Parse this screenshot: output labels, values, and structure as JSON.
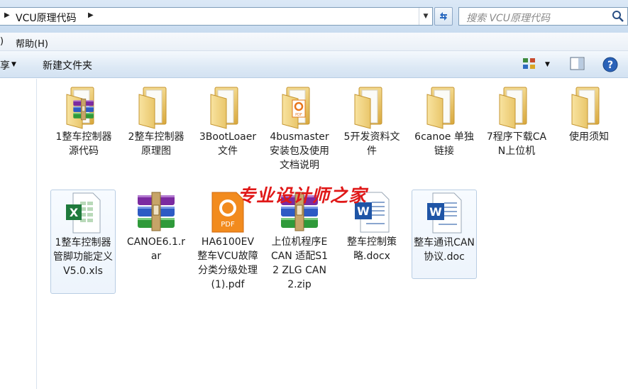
{
  "address": {
    "path": "VCU原理代码",
    "search_placeholder": "搜索 VCU原理代码"
  },
  "menu": {
    "fragment": ")",
    "help": "帮助(H)"
  },
  "toolbar": {
    "share_fragment": "享",
    "new_folder": "新建文件夹"
  },
  "items": [
    {
      "label": "1整车控制器源代码",
      "icon": "rar-folder-icon"
    },
    {
      "label": "2整车控制器原理图",
      "icon": "folder-icon"
    },
    {
      "label": "3BootLoaer文件",
      "icon": "folder-icon"
    },
    {
      "label": "4busmaster安装包及使用文档说明",
      "icon": "pdf-folder-icon"
    },
    {
      "label": "5开发资料文件",
      "icon": "folder-icon"
    },
    {
      "label": "6canoe 单独链接",
      "icon": "folder-icon"
    },
    {
      "label": "7程序下载CAN上位机",
      "icon": "folder-icon"
    },
    {
      "label": "使用须知",
      "icon": "folder-icon"
    },
    {
      "label": "1整车控制器管脚功能定义V5.0.xls",
      "icon": "excel-icon"
    },
    {
      "label": "CANOE6.1.rar",
      "icon": "rar-icon"
    },
    {
      "label": "HA6100EV整车VCU故障分类分级处理(1).pdf",
      "icon": "pdf-icon"
    },
    {
      "label": "上位机程序ECAN 适配S12 ZLG CAN2.zip",
      "icon": "zip-icon"
    },
    {
      "label": "整车控制策略.docx",
      "icon": "word-icon"
    },
    {
      "label": "整车通讯CAN协议.doc",
      "icon": "word-icon"
    }
  ],
  "watermark": "专业设计师之家"
}
